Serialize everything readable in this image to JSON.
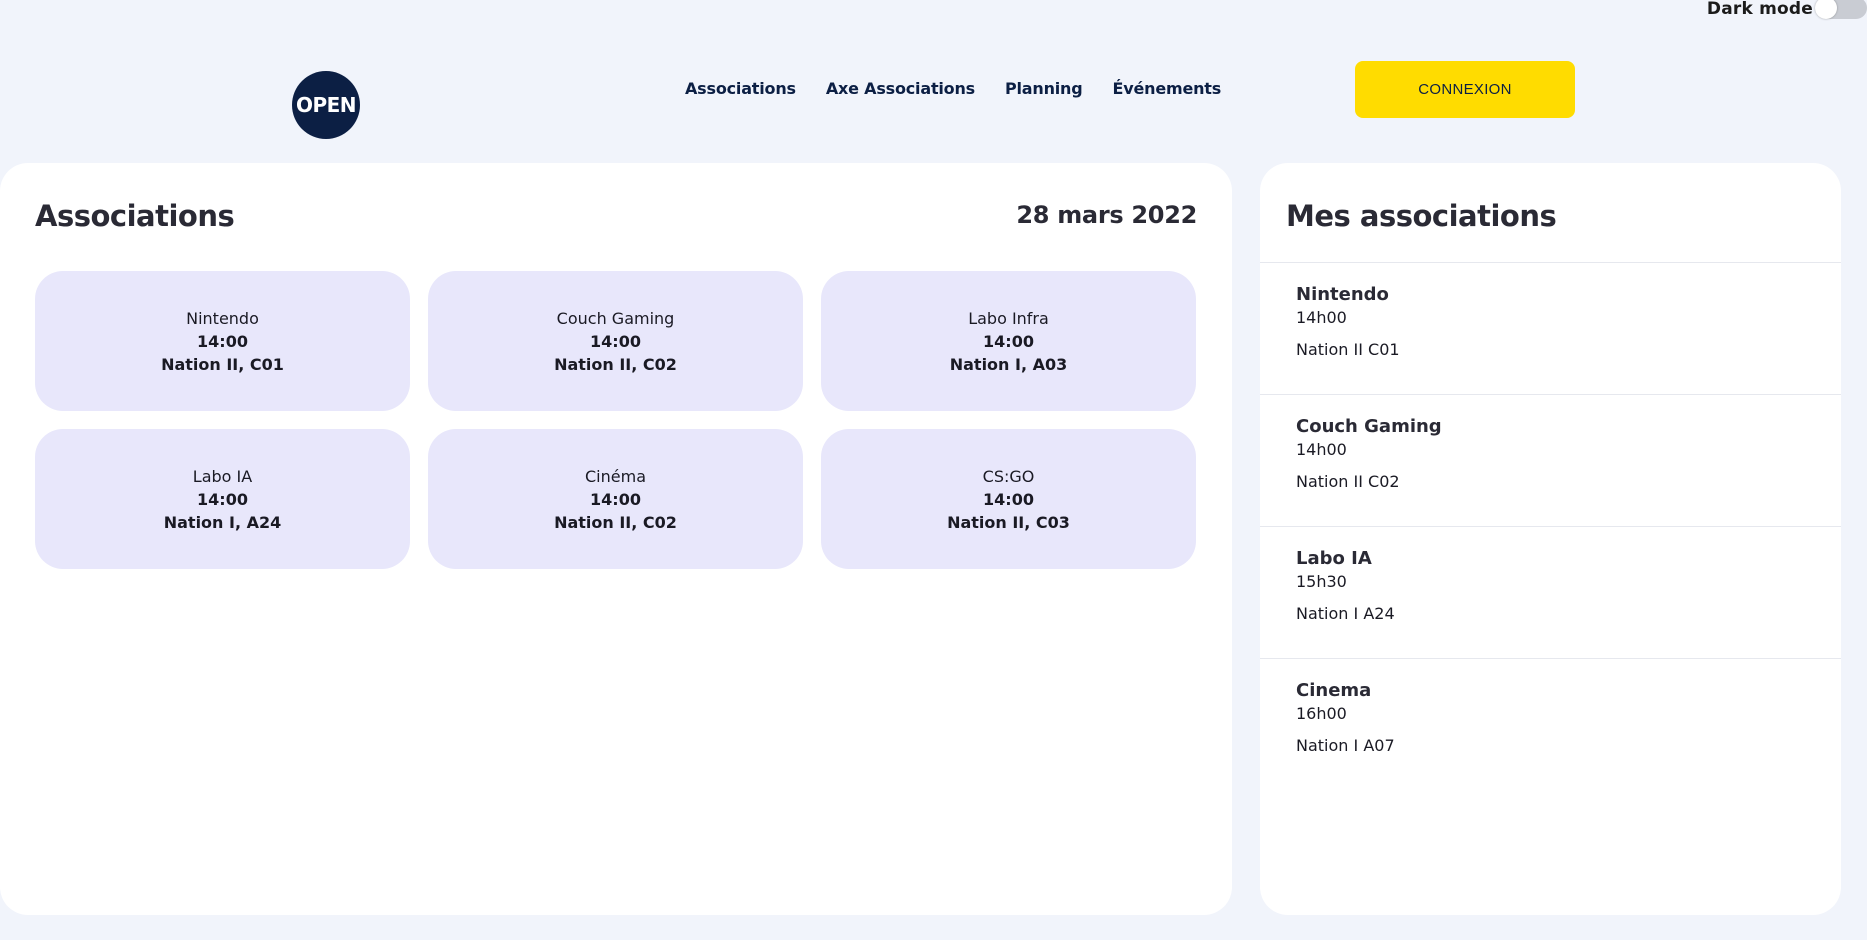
{
  "header": {
    "dark_mode_label": "Dark mode",
    "dark_mode_on": false,
    "logo_text": "OPEN",
    "nav": [
      "Associations",
      "Axe Associations",
      "Planning",
      "Événements"
    ],
    "login_label": "CONNEXION"
  },
  "main": {
    "title": "Associations",
    "date": "28 mars 2022",
    "cards": [
      {
        "name": "Nintendo",
        "time": "14:00",
        "room": "Nation II, C01"
      },
      {
        "name": "Couch Gaming",
        "time": "14:00",
        "room": "Nation II, C02"
      },
      {
        "name": "Labo Infra",
        "time": "14:00",
        "room": "Nation I, A03"
      },
      {
        "name": "Labo IA",
        "time": "14:00",
        "room": "Nation I, A24"
      },
      {
        "name": "Cinéma",
        "time": "14:00",
        "room": "Nation II, C02"
      },
      {
        "name": "CS:GO",
        "time": "14:00",
        "room": "Nation II, C03"
      }
    ]
  },
  "side": {
    "title": "Mes associations",
    "items": [
      {
        "name": "Nintendo",
        "time": "14h00",
        "room": "Nation II C01"
      },
      {
        "name": "Couch Gaming",
        "time": "14h00",
        "room": "Nation II C02"
      },
      {
        "name": "Labo IA",
        "time": "15h30",
        "room": "Nation I A24"
      },
      {
        "name": "Cinema",
        "time": "16h00",
        "room": "Nation I A07"
      }
    ]
  },
  "colors": {
    "background": "#f1f4fb",
    "brand_navy": "#0c1f44",
    "accent_yellow": "#ffdc00",
    "card_lavender": "#e8e7fb"
  }
}
